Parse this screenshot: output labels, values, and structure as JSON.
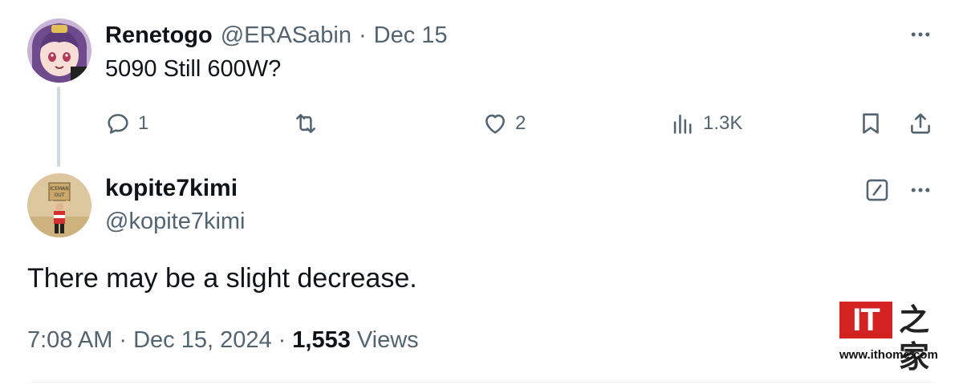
{
  "reply_tweet": {
    "display_name": "Renetogo",
    "handle": "@ERASabin",
    "separator": "·",
    "date": "Dec 15",
    "text": "5090 Still 600W?",
    "actions": {
      "reply_count": "1",
      "retweet_count": "",
      "like_count": "2",
      "views_count": "1.3K"
    },
    "avatar_icon": "anime-avatar-icon"
  },
  "main_tweet": {
    "display_name": "kopite7kimi",
    "handle": "@kopite7kimi",
    "text": "There may be a slight decrease.",
    "time": "7:08 AM",
    "separator": "·",
    "date": "Dec 15, 2024",
    "views_count": "1,553",
    "views_label": "Views",
    "avatar_sign_text": "ICEMAN OUT",
    "avatar_icon": "person-holding-sign-avatar-icon"
  },
  "icons": {
    "reply": "reply-icon",
    "retweet": "retweet-icon",
    "like": "heart-icon",
    "views": "analytics-icon",
    "bookmark": "bookmark-icon",
    "share": "share-icon",
    "more": "more-icon",
    "edit": "edit-icon"
  },
  "watermark": {
    "logo_text": "IT",
    "cn_text": "之家",
    "url": "www.ithome.com"
  },
  "colors": {
    "text_primary": "#0f1419",
    "text_secondary": "#536471",
    "thread_line": "#cfd9de",
    "watermark_red": "#d22222"
  }
}
